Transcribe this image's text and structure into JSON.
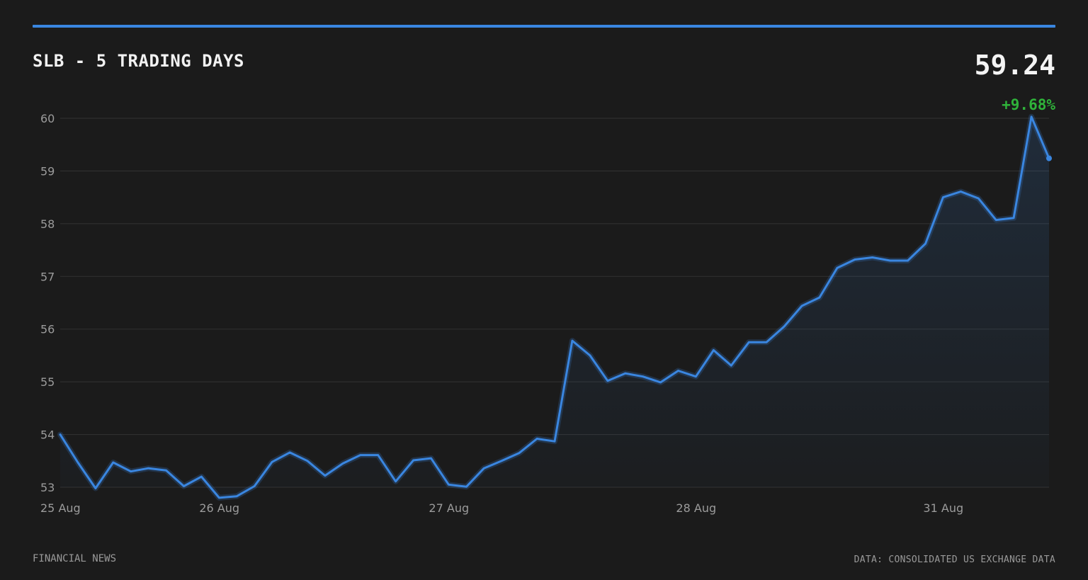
{
  "header": {
    "title": "SLB - 5 TRADING DAYS",
    "price": "59.24",
    "change": "+9.68%"
  },
  "footer": {
    "source_left": "FINANCIAL NEWS",
    "source_right": "DATA: CONSOLIDATED US EXCHANGE DATA"
  },
  "colors": {
    "line": "#3a86e0",
    "positive": "#2fb33a",
    "background": "#1b1b1b"
  },
  "chart_data": {
    "type": "area",
    "title": "SLB - 5 TRADING DAYS",
    "xlabel": "",
    "ylabel": "",
    "ylim": [
      53,
      60
    ],
    "yticks": [
      53,
      54,
      55,
      56,
      57,
      58,
      59,
      60
    ],
    "grid": true,
    "x_tick_labels": [
      {
        "label": "25 Aug",
        "index": 0
      },
      {
        "label": "26 Aug",
        "index": 9
      },
      {
        "label": "27 Aug",
        "index": 22
      },
      {
        "label": "28 Aug",
        "index": 36
      },
      {
        "label": "31 Aug",
        "index": 50
      }
    ],
    "series": [
      {
        "values": [
          54.0,
          53.47,
          52.98,
          53.47,
          53.3,
          53.36,
          53.32,
          53.02,
          53.2,
          52.8,
          52.83,
          53.02,
          53.48,
          53.66,
          53.5,
          53.22,
          53.45,
          53.61,
          53.61,
          53.11,
          53.51,
          53.55,
          53.05,
          53.01,
          53.36,
          53.5,
          53.65,
          53.92,
          53.87,
          55.78,
          55.5,
          55.02,
          55.16,
          55.1,
          54.99,
          55.21,
          55.1,
          55.6,
          55.31,
          55.75,
          55.75,
          56.05,
          56.44,
          56.6,
          57.16,
          57.32,
          57.36,
          57.3,
          57.3,
          57.62,
          58.5,
          58.61,
          58.48,
          58.07,
          58.11,
          60.03,
          59.24
        ]
      }
    ]
  }
}
